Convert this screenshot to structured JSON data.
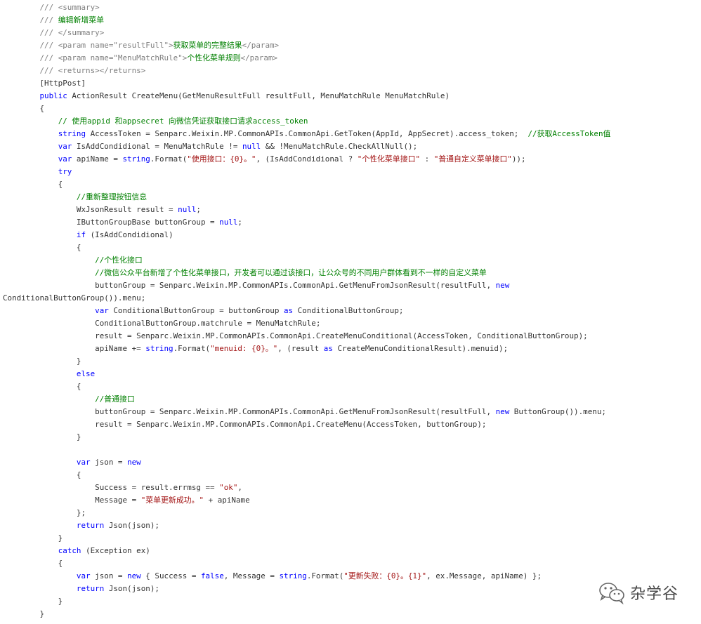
{
  "code_lines": [
    [
      {
        "t": "        ",
        "c": "pl"
      },
      {
        "t": "/// <summary>",
        "c": "gr"
      }
    ],
    [
      {
        "t": "        ",
        "c": "pl"
      },
      {
        "t": "/// ",
        "c": "gr"
      },
      {
        "t": "编辑新增菜单",
        "c": "cm"
      }
    ],
    [
      {
        "t": "        ",
        "c": "pl"
      },
      {
        "t": "/// </summary>",
        "c": "gr"
      }
    ],
    [
      {
        "t": "        ",
        "c": "pl"
      },
      {
        "t": "/// <param name=\"resultFull\">",
        "c": "gr"
      },
      {
        "t": "获取菜单的完整结果",
        "c": "cm"
      },
      {
        "t": "</param>",
        "c": "gr"
      }
    ],
    [
      {
        "t": "        ",
        "c": "pl"
      },
      {
        "t": "/// <param name=\"MenuMatchRule\">",
        "c": "gr"
      },
      {
        "t": "个性化菜单规则",
        "c": "cm"
      },
      {
        "t": "</param>",
        "c": "gr"
      }
    ],
    [
      {
        "t": "        ",
        "c": "pl"
      },
      {
        "t": "/// <returns></returns>",
        "c": "gr"
      }
    ],
    [
      {
        "t": "        [HttpPost]",
        "c": "pl"
      }
    ],
    [
      {
        "t": "        ",
        "c": "pl"
      },
      {
        "t": "public",
        "c": "kw"
      },
      {
        "t": " ActionResult CreateMenu(GetMenuResultFull resultFull, MenuMatchRule MenuMatchRule)",
        "c": "pl"
      }
    ],
    [
      {
        "t": "        {",
        "c": "pl"
      }
    ],
    [
      {
        "t": "            ",
        "c": "pl"
      },
      {
        "t": "// 使用appid 和appsecret 向微信凭证获取接口请求access_token",
        "c": "cm"
      }
    ],
    [
      {
        "t": "            ",
        "c": "pl"
      },
      {
        "t": "string",
        "c": "kw"
      },
      {
        "t": " AccessToken = Senparc.Weixin.MP.CommonAPIs.CommonApi.GetToken(AppId, AppSecret).access_token;  ",
        "c": "pl"
      },
      {
        "t": "//获取AccessToken值",
        "c": "cm"
      }
    ],
    [
      {
        "t": "            ",
        "c": "pl"
      },
      {
        "t": "var",
        "c": "kw"
      },
      {
        "t": " IsAddCondidional = MenuMatchRule != ",
        "c": "pl"
      },
      {
        "t": "null",
        "c": "kw"
      },
      {
        "t": " && !MenuMatchRule.CheckAllNull();",
        "c": "pl"
      }
    ],
    [
      {
        "t": "            ",
        "c": "pl"
      },
      {
        "t": "var",
        "c": "kw"
      },
      {
        "t": " apiName = ",
        "c": "pl"
      },
      {
        "t": "string",
        "c": "kw"
      },
      {
        "t": ".Format(",
        "c": "pl"
      },
      {
        "t": "\"使用接口：{0}。\"",
        "c": "str"
      },
      {
        "t": ", (IsAddCondidional ? ",
        "c": "pl"
      },
      {
        "t": "\"个性化菜单接口\"",
        "c": "str"
      },
      {
        "t": " : ",
        "c": "pl"
      },
      {
        "t": "\"普通自定义菜单接口\"",
        "c": "str"
      },
      {
        "t": "));",
        "c": "pl"
      }
    ],
    [
      {
        "t": "            ",
        "c": "pl"
      },
      {
        "t": "try",
        "c": "kw"
      }
    ],
    [
      {
        "t": "            {",
        "c": "pl"
      }
    ],
    [
      {
        "t": "                ",
        "c": "pl"
      },
      {
        "t": "//重新整理按钮信息",
        "c": "cm"
      }
    ],
    [
      {
        "t": "                WxJsonResult result = ",
        "c": "pl"
      },
      {
        "t": "null",
        "c": "kw"
      },
      {
        "t": ";",
        "c": "pl"
      }
    ],
    [
      {
        "t": "                IButtonGroupBase buttonGroup = ",
        "c": "pl"
      },
      {
        "t": "null",
        "c": "kw"
      },
      {
        "t": ";",
        "c": "pl"
      }
    ],
    [
      {
        "t": "                ",
        "c": "pl"
      },
      {
        "t": "if",
        "c": "kw"
      },
      {
        "t": " (IsAddCondidional)",
        "c": "pl"
      }
    ],
    [
      {
        "t": "                {",
        "c": "pl"
      }
    ],
    [
      {
        "t": "                    ",
        "c": "pl"
      },
      {
        "t": "//个性化接口",
        "c": "cm"
      }
    ],
    [
      {
        "t": "                    ",
        "c": "pl"
      },
      {
        "t": "//微信公众平台新增了个性化菜单接口，开发者可以通过该接口，让公众号的不同用户群体看到不一样的自定义菜单",
        "c": "cm"
      }
    ],
    [
      {
        "t": "                    buttonGroup = Senparc.Weixin.MP.CommonAPIs.CommonApi.GetMenuFromJsonResult(resultFull, ",
        "c": "pl"
      },
      {
        "t": "new",
        "c": "kw"
      }
    ],
    [
      {
        "t": "ConditionalButtonGroup()).menu;",
        "c": "pl"
      }
    ],
    [
      {
        "t": "                    ",
        "c": "pl"
      },
      {
        "t": "var",
        "c": "kw"
      },
      {
        "t": " ConditionalButtonGroup = buttonGroup ",
        "c": "pl"
      },
      {
        "t": "as",
        "c": "kw"
      },
      {
        "t": " ConditionalButtonGroup;",
        "c": "pl"
      }
    ],
    [
      {
        "t": "                    ConditionalButtonGroup.matchrule = MenuMatchRule;",
        "c": "pl"
      }
    ],
    [
      {
        "t": "                    result = Senparc.Weixin.MP.CommonAPIs.CommonApi.CreateMenuConditional(AccessToken, ConditionalButtonGroup);",
        "c": "pl"
      }
    ],
    [
      {
        "t": "                    apiName += ",
        "c": "pl"
      },
      {
        "t": "string",
        "c": "kw"
      },
      {
        "t": ".Format(",
        "c": "pl"
      },
      {
        "t": "\"menuid: {0}。\"",
        "c": "str"
      },
      {
        "t": ", (result ",
        "c": "pl"
      },
      {
        "t": "as",
        "c": "kw"
      },
      {
        "t": " CreateMenuConditionalResult).menuid);",
        "c": "pl"
      }
    ],
    [
      {
        "t": "                }",
        "c": "pl"
      }
    ],
    [
      {
        "t": "                ",
        "c": "pl"
      },
      {
        "t": "else",
        "c": "kw"
      }
    ],
    [
      {
        "t": "                {",
        "c": "pl"
      }
    ],
    [
      {
        "t": "                    ",
        "c": "pl"
      },
      {
        "t": "//普通接口",
        "c": "cm"
      }
    ],
    [
      {
        "t": "                    buttonGroup = Senparc.Weixin.MP.CommonAPIs.CommonApi.GetMenuFromJsonResult(resultFull, ",
        "c": "pl"
      },
      {
        "t": "new",
        "c": "kw"
      },
      {
        "t": " ButtonGroup()).menu;",
        "c": "pl"
      }
    ],
    [
      {
        "t": "                    result = Senparc.Weixin.MP.CommonAPIs.CommonApi.CreateMenu(AccessToken, buttonGroup);",
        "c": "pl"
      }
    ],
    [
      {
        "t": "                }",
        "c": "pl"
      }
    ],
    [
      {
        "t": "",
        "c": "pl"
      }
    ],
    [
      {
        "t": "                ",
        "c": "pl"
      },
      {
        "t": "var",
        "c": "kw"
      },
      {
        "t": " json = ",
        "c": "pl"
      },
      {
        "t": "new",
        "c": "kw"
      }
    ],
    [
      {
        "t": "                {",
        "c": "pl"
      }
    ],
    [
      {
        "t": "                    Success = result.errmsg == ",
        "c": "pl"
      },
      {
        "t": "\"ok\"",
        "c": "str"
      },
      {
        "t": ",",
        "c": "pl"
      }
    ],
    [
      {
        "t": "                    Message = ",
        "c": "pl"
      },
      {
        "t": "\"菜单更新成功。\"",
        "c": "str"
      },
      {
        "t": " + apiName",
        "c": "pl"
      }
    ],
    [
      {
        "t": "                };",
        "c": "pl"
      }
    ],
    [
      {
        "t": "                ",
        "c": "pl"
      },
      {
        "t": "return",
        "c": "kw"
      },
      {
        "t": " Json(json);",
        "c": "pl"
      }
    ],
    [
      {
        "t": "            }",
        "c": "pl"
      }
    ],
    [
      {
        "t": "            ",
        "c": "pl"
      },
      {
        "t": "catch",
        "c": "kw"
      },
      {
        "t": " (Exception ex)",
        "c": "pl"
      }
    ],
    [
      {
        "t": "            {",
        "c": "pl"
      }
    ],
    [
      {
        "t": "                ",
        "c": "pl"
      },
      {
        "t": "var",
        "c": "kw"
      },
      {
        "t": " json = ",
        "c": "pl"
      },
      {
        "t": "new",
        "c": "kw"
      },
      {
        "t": " { Success = ",
        "c": "pl"
      },
      {
        "t": "false",
        "c": "kw"
      },
      {
        "t": ", Message = ",
        "c": "pl"
      },
      {
        "t": "string",
        "c": "kw"
      },
      {
        "t": ".Format(",
        "c": "pl"
      },
      {
        "t": "\"更新失败：{0}。{1}\"",
        "c": "str"
      },
      {
        "t": ", ex.Message, apiName) };",
        "c": "pl"
      }
    ],
    [
      {
        "t": "                ",
        "c": "pl"
      },
      {
        "t": "return",
        "c": "kw"
      },
      {
        "t": " Json(json);",
        "c": "pl"
      }
    ],
    [
      {
        "t": "            }",
        "c": "pl"
      }
    ],
    [
      {
        "t": "        }",
        "c": "pl"
      }
    ]
  ],
  "watermark": {
    "icon": "wechat-icon",
    "text": "杂学谷"
  },
  "colors": {
    "keyword": "#0000ff",
    "comment": "#008000",
    "doc_comment": "#808080",
    "string": "#a31515",
    "plain": "#333333",
    "background": "#ffffff"
  }
}
